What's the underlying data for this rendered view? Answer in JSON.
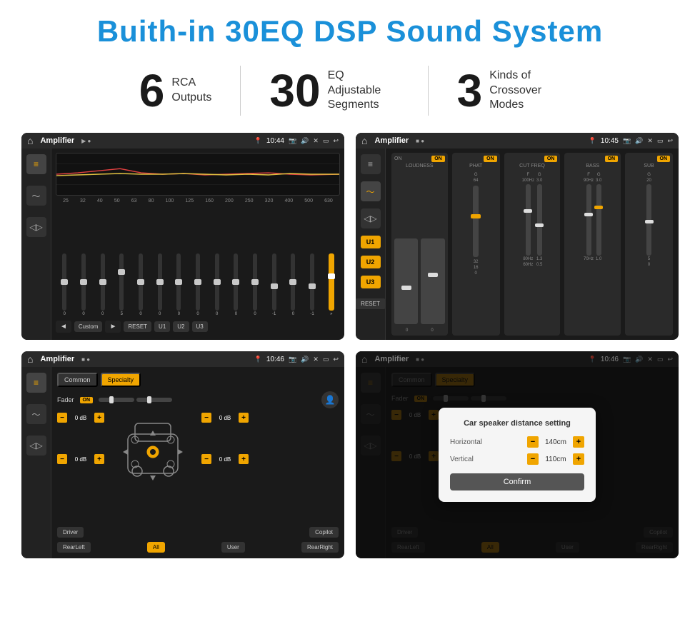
{
  "page": {
    "title": "Buith-in 30EQ DSP Sound System",
    "stats": [
      {
        "number": "6",
        "label": "RCA\nOutputs"
      },
      {
        "number": "30",
        "label": "EQ Adjustable\nSegments"
      },
      {
        "number": "3",
        "label": "Kinds of\nCrossover Modes"
      }
    ],
    "screens": [
      {
        "id": "eq-screen",
        "app_name": "Amplifier",
        "time": "10:44",
        "type": "equalizer"
      },
      {
        "id": "crossover-screen",
        "app_name": "Amplifier",
        "time": "10:45",
        "type": "crossover"
      },
      {
        "id": "fader-screen",
        "app_name": "Amplifier",
        "time": "10:46",
        "type": "fader"
      },
      {
        "id": "dialog-screen",
        "app_name": "Amplifier",
        "time": "10:46",
        "type": "dialog"
      }
    ],
    "eq": {
      "frequencies": [
        "25",
        "32",
        "40",
        "50",
        "63",
        "80",
        "100",
        "125",
        "160",
        "200",
        "250",
        "320",
        "400",
        "500",
        "630"
      ],
      "values": [
        "0",
        "0",
        "0",
        "5",
        "0",
        "0",
        "0",
        "0",
        "0",
        "0",
        "0",
        "-1",
        "0",
        "-1"
      ],
      "presets": [
        "Custom",
        "RESET",
        "U1",
        "U2",
        "U3"
      ]
    },
    "crossover": {
      "units": [
        "U1",
        "U2",
        "U3"
      ],
      "modules": [
        "LOUDNESS",
        "PHAT",
        "CUT FREQ",
        "BASS",
        "SUB"
      ],
      "reset_label": "RESET"
    },
    "fader": {
      "tabs": [
        "Common",
        "Specialty"
      ],
      "fader_label": "Fader",
      "on_label": "ON",
      "volume_labels": [
        "0 dB",
        "0 dB",
        "0 dB",
        "0 dB"
      ],
      "bottom_btns": [
        "Driver",
        "",
        "Copilot",
        "RearLeft",
        "All",
        "",
        "User",
        "RearRight"
      ]
    },
    "dialog": {
      "title": "Car speaker distance setting",
      "horizontal_label": "Horizontal",
      "horizontal_value": "140cm",
      "vertical_label": "Vertical",
      "vertical_value": "110cm",
      "confirm_label": "Confirm",
      "fader_tabs": [
        "Common",
        "Specialty"
      ],
      "on_label": "ON",
      "bottom_btns": [
        "Driver",
        "Copilot",
        "RearLeft",
        "All",
        "User",
        "RearRight"
      ]
    },
    "colors": {
      "accent": "#f0a500",
      "bg_dark": "#1a1a1a",
      "text_light": "#ffffff",
      "title_blue": "#1a90d9"
    }
  }
}
